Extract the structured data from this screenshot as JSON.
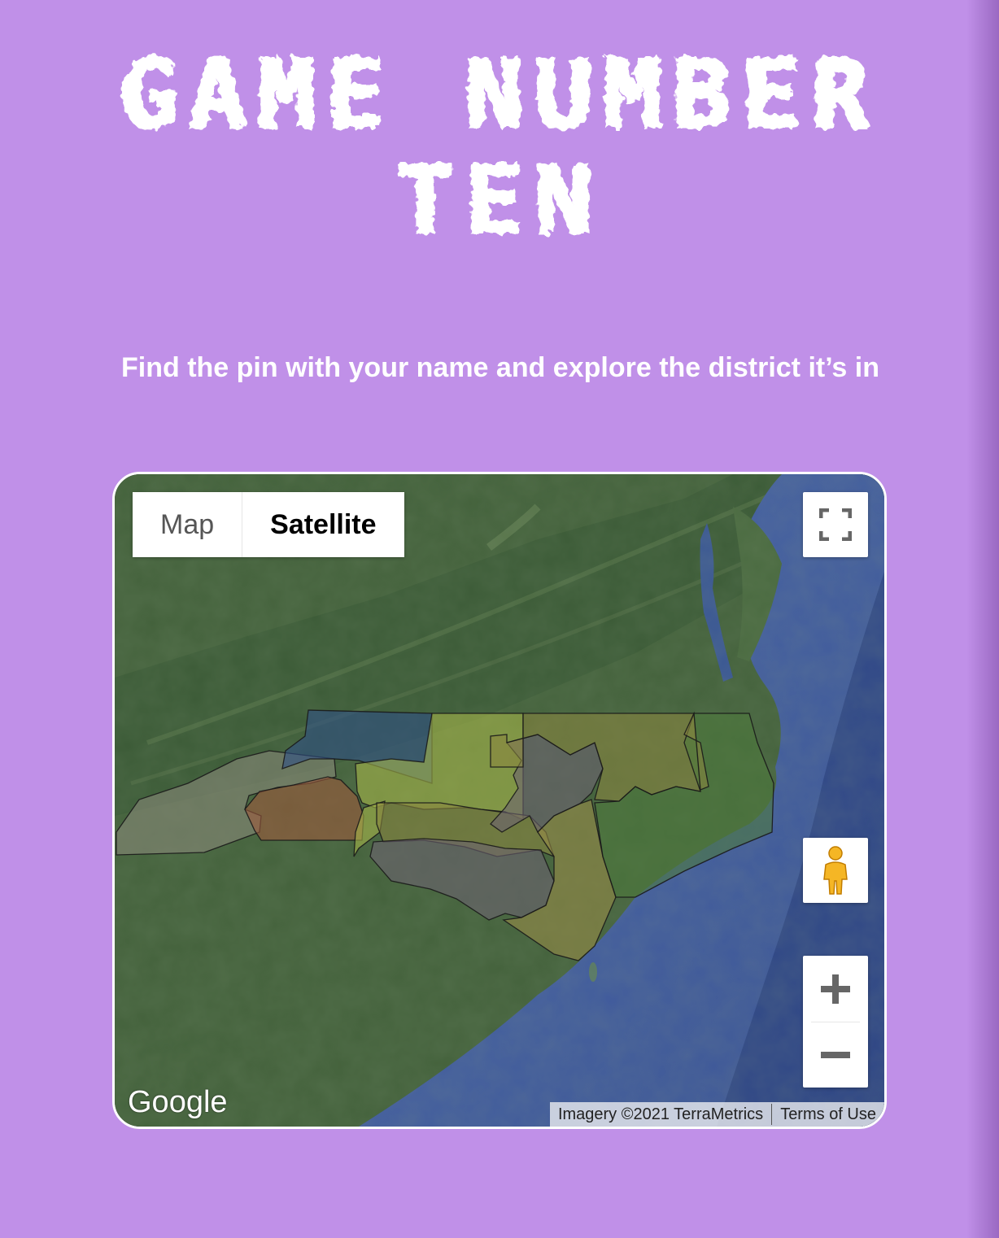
{
  "page": {
    "title_lines": [
      "GAME NUMBER",
      "TEN"
    ],
    "subtitle": "Find the pin with your name and explore the district it’s in"
  },
  "map": {
    "type_controls": {
      "map_label": "Map",
      "satellite_label": "Satellite",
      "selected": "Satellite"
    },
    "logo": "Google",
    "attribution": "Imagery ©2021 TerraMetrics",
    "terms_label": "Terms of Use",
    "icons": {
      "fullscreen": "fullscreen-icon",
      "pegman": "pegman-icon",
      "zoom_in": "zoom-in-icon",
      "zoom_out": "zoom-out-icon"
    },
    "district_colors": [
      "#8a8a7a",
      "#2f4f88",
      "#9e5a3c",
      "#a8b84a",
      "#8a8640",
      "#6c6272",
      "#9a8e48",
      "#4d7a3c"
    ]
  }
}
